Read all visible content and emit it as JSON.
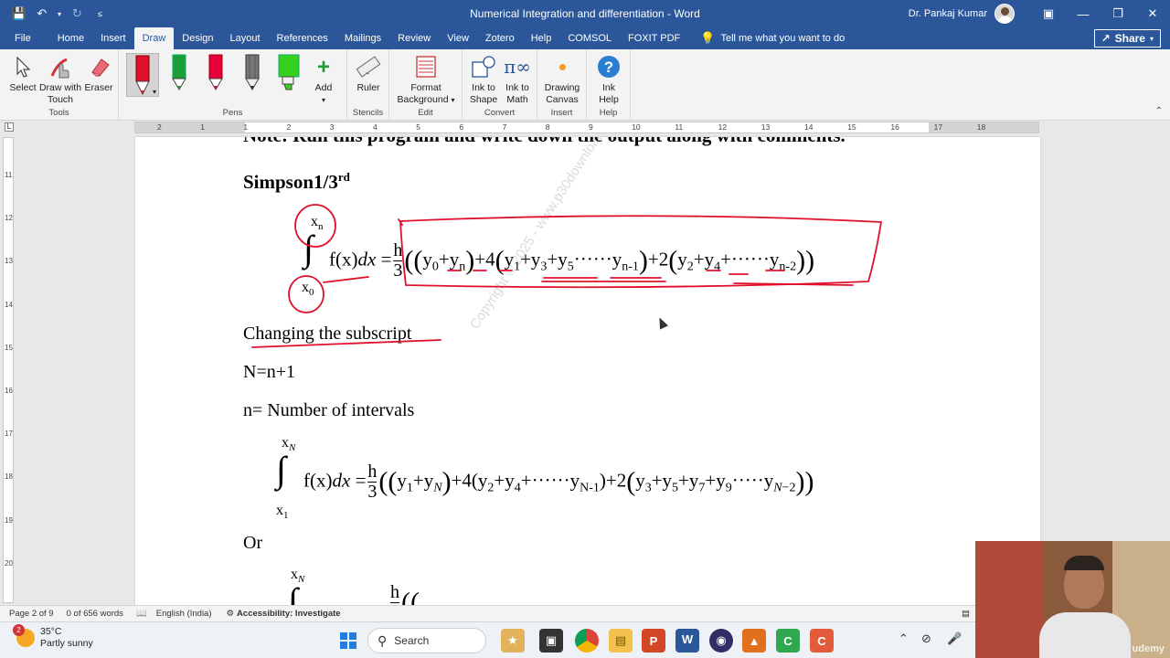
{
  "titlebar": {
    "doc_title": "Numerical Integration and differentiation  -  Word",
    "user_name": "Dr. Pankaj Kumar"
  },
  "tabs": [
    "File",
    "Home",
    "Insert",
    "Draw",
    "Design",
    "Layout",
    "References",
    "Mailings",
    "Review",
    "View",
    "Zotero",
    "Help",
    "COMSOL",
    "FOXIT PDF"
  ],
  "active_tab": "Draw",
  "tell_me": "Tell me what you want to do",
  "share_label": "Share",
  "ribbon": {
    "tools": {
      "label": "Tools",
      "select": "Select",
      "draw_touch_1": "Draw with",
      "draw_touch_2": "Touch",
      "eraser": "Eraser"
    },
    "pens": {
      "label": "Pens",
      "add": "Add",
      "colors": [
        "#e0102a",
        "#1b9e3a",
        "#e8003c",
        "#555555",
        "#36d11c"
      ]
    },
    "stencils": {
      "label": "Stencils",
      "ruler": "Ruler"
    },
    "edit": {
      "label": "Edit",
      "format_bg_1": "Format",
      "format_bg_2": "Background"
    },
    "convert": {
      "label": "Convert",
      "ink_shape_1": "Ink to",
      "ink_shape_2": "Shape",
      "ink_math_1": "Ink to",
      "ink_math_2": "Math"
    },
    "insert": {
      "label": "Insert",
      "drawing_canvas_1": "Drawing",
      "drawing_canvas_2": "Canvas"
    },
    "help": {
      "label": "Help",
      "ink_help_1": "Ink",
      "ink_help_2": "Help"
    }
  },
  "ruler": {
    "h_ticks": [
      "2",
      "1",
      "1",
      "2",
      "3",
      "4",
      "5",
      "6",
      "7",
      "8",
      "9",
      "10",
      "11",
      "12",
      "13",
      "14",
      "15",
      "16",
      "17",
      "18"
    ],
    "v_ticks": [
      "11",
      "12",
      "13",
      "14",
      "15",
      "16",
      "17",
      "18",
      "19",
      "20"
    ]
  },
  "document": {
    "top_cut": "Note: Run this program and write down the output along with comments.",
    "heading_main": "Simpson1/3",
    "heading_sup": "rd",
    "subscript_heading": "Changing the subscript",
    "n_eq": "N=n+1",
    "n_def": "n= Number of intervals",
    "or_text": "Or",
    "watermark": "Copyright © 2025 - www.p30download.com"
  },
  "statusbar": {
    "page": "Page 2 of 9",
    "words": "0 of 656 words",
    "language": "English (India)",
    "accessibility": "Accessibility: Investigate"
  },
  "taskbar": {
    "temp": "35°C",
    "weather": "Partly sunny",
    "weather_badge": "2",
    "search": "Search"
  },
  "webcam_logo": "udemy"
}
